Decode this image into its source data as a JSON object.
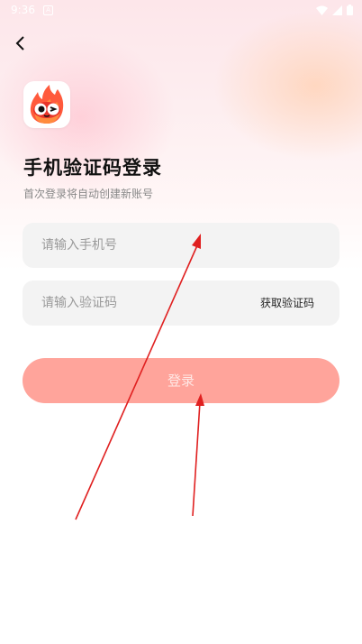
{
  "status_bar": {
    "time": "9:36",
    "notification_glyph": "A"
  },
  "header": {
    "back_icon": "chevron-left-icon"
  },
  "brand": {
    "logo_icon": "fire-mascot-logo"
  },
  "title": "手机验证码登录",
  "subtitle": "首次登录将自动创建新账号",
  "phone_field": {
    "placeholder": "请输入手机号",
    "value": ""
  },
  "code_field": {
    "placeholder": "请输入验证码",
    "value": "",
    "get_code_label": "获取验证码"
  },
  "login_button": {
    "label": "登录"
  },
  "colors": {
    "accent": "#ffa49b",
    "annotation_arrow": "#e02020"
  }
}
